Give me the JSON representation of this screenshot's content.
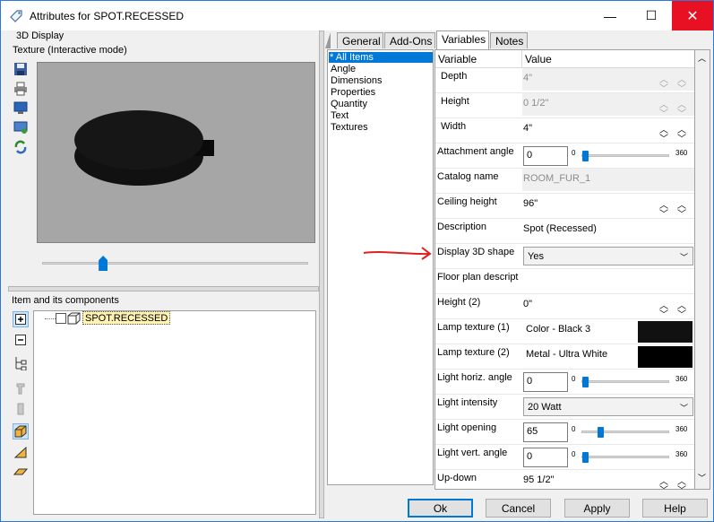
{
  "window": {
    "title": "Attributes for SPOT.RECESSED",
    "minimize": "—",
    "maximize": "☐",
    "close": "✕"
  },
  "left": {
    "section_3d": "3D Display",
    "texture_mode": "Texture (Interactive mode)",
    "toolbar_icons": [
      "save-icon",
      "print-icon",
      "monitor-icon",
      "monitor-settings-icon",
      "refresh-icon"
    ],
    "slider_value": 0.22,
    "components_label": "Item and its components",
    "tree_item": "SPOT.RECESSED",
    "tree_tools": [
      "expand-icon",
      "collapse-icon",
      "tree-icon",
      "handle-icon",
      "handle-icon",
      "box-icon",
      "wedge-icon",
      "plane-icon"
    ]
  },
  "tabs": [
    "General",
    "Add-Ons",
    "Variables",
    "Notes"
  ],
  "active_tab": "Variables",
  "categories": [
    "* All Items",
    "Angle",
    "Dimensions",
    "Properties",
    "Quantity",
    "Text",
    "Textures"
  ],
  "grid": {
    "col_variable": "Variable",
    "col_value": "Value",
    "rows": {
      "depth": {
        "name": "Depth",
        "value": "4\""
      },
      "height": {
        "name": "Height",
        "value": "0 1/2\""
      },
      "width": {
        "name": "Width",
        "value": "4\""
      },
      "attachment_angle": {
        "name": "Attachment angle",
        "value": "0",
        "min": "0",
        "max": "360",
        "level": 0
      },
      "catalog_name": {
        "name": "Catalog name",
        "value": "ROOM_FUR_1"
      },
      "ceiling_height": {
        "name": "Ceiling height",
        "value": "96\""
      },
      "description": {
        "name": "Description",
        "value": "Spot (Recessed)"
      },
      "display_3d": {
        "name": "Display 3D shape",
        "value": "Yes"
      },
      "floor_plan": {
        "name": "Floor plan descript",
        "value": ""
      },
      "height2": {
        "name": "Height (2)",
        "value": "0\""
      },
      "lamp_tex1": {
        "name": "Lamp texture (1)",
        "value": "Color - Black 3",
        "swatch": "#111111"
      },
      "lamp_tex2": {
        "name": "Lamp texture (2)",
        "value": "Metal - Ultra White",
        "swatch": "#000000"
      },
      "light_horiz": {
        "name": "Light horiz. angle",
        "value": "0",
        "min": "0",
        "max": "360",
        "level": 0
      },
      "light_intensity": {
        "name": "Light intensity",
        "value": "20 Watt"
      },
      "light_opening": {
        "name": "Light opening",
        "value": "65",
        "min": "0",
        "max": "360",
        "level": 0.18
      },
      "light_vert": {
        "name": "Light vert. angle",
        "value": "0",
        "min": "0",
        "max": "360",
        "level": 0
      },
      "up_down": {
        "name": "Up-down",
        "value": "95 1/2\""
      }
    }
  },
  "buttons": {
    "ok": "Ok",
    "cancel": "Cancel",
    "apply": "Apply",
    "help": "Help"
  },
  "colors": {
    "accent": "#0078d7",
    "annotation": "#e02020",
    "close_red": "#e81123"
  }
}
